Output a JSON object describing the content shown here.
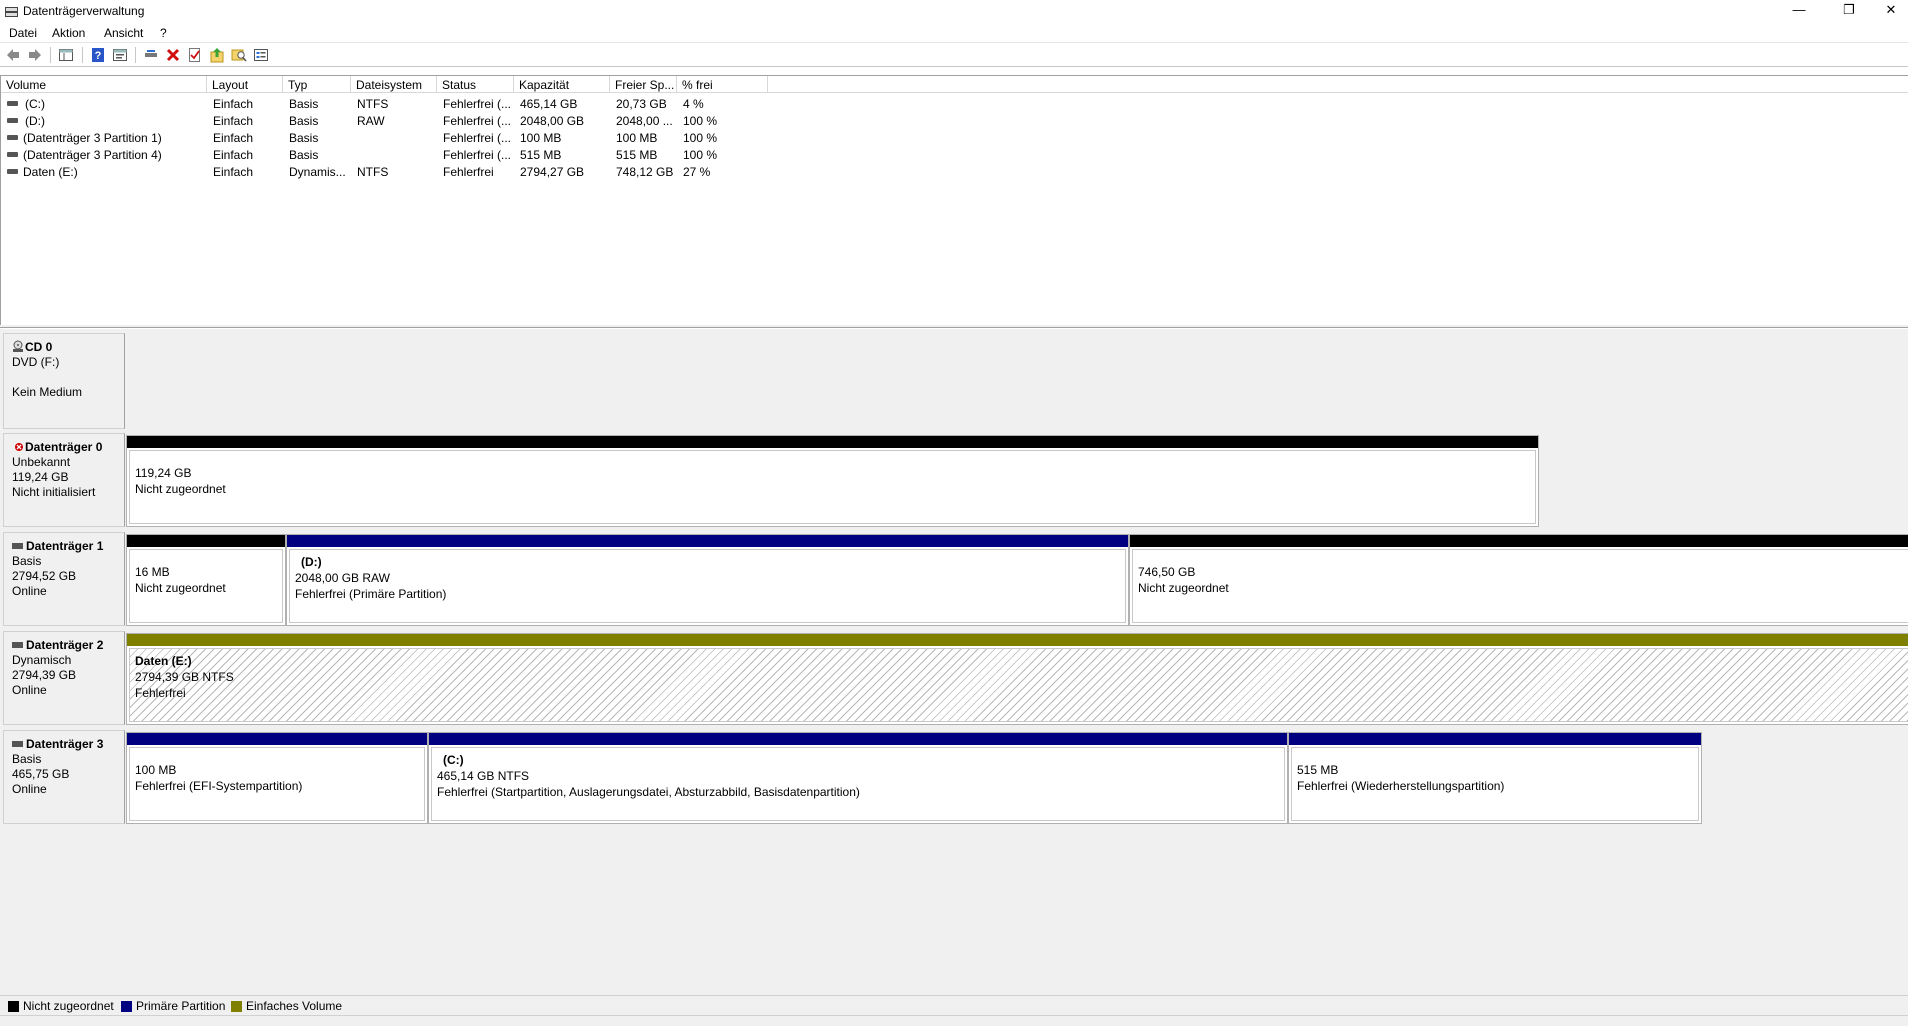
{
  "window": {
    "title": "Datenträgerverwaltung",
    "minimize": "—",
    "maximize": "❐",
    "close": "✕"
  },
  "menu": [
    "Datei",
    "Aktion",
    "Ansicht",
    "?"
  ],
  "toolbar": {
    "icons": [
      "back-icon",
      "forward-icon",
      "console-tree-icon",
      "help-icon",
      "properties-icon",
      "connect-icon",
      "delete-icon",
      "check-icon",
      "import-icon",
      "search-icon",
      "list-icon"
    ]
  },
  "volume_list": {
    "columns": [
      "Volume",
      "Layout",
      "Typ",
      "Dateisystem",
      "Status",
      "Kapazität",
      "Freier Sp...",
      "% frei"
    ],
    "rows": [
      [
        "(C:)",
        "Einfach",
        "Basis",
        "NTFS",
        "Fehlerfrei (...",
        "465,14 GB",
        "20,73 GB",
        "4 %"
      ],
      [
        "(D:)",
        "Einfach",
        "Basis",
        "RAW",
        "Fehlerfrei (...",
        "2048,00 GB",
        "2048,00 ...",
        "100 %"
      ],
      [
        "(Datenträger 3 Partition 1)",
        "Einfach",
        "Basis",
        "",
        "Fehlerfrei (...",
        "100 MB",
        "100 MB",
        "100 %"
      ],
      [
        "(Datenträger 3 Partition 4)",
        "Einfach",
        "Basis",
        "",
        "Fehlerfrei (...",
        "515 MB",
        "515 MB",
        "100 %"
      ],
      [
        "Daten (E:)",
        "Einfach",
        "Dynamis...",
        "NTFS",
        "Fehlerfrei",
        "2794,27 GB",
        "748,12 GB",
        "27 %"
      ]
    ]
  },
  "disks": [
    {
      "name": "CD 0",
      "lines": [
        "DVD (F:)",
        "",
        "Kein Medium"
      ],
      "partitions": []
    },
    {
      "name": "Datenträger 0",
      "lines": [
        "Unbekannt",
        "119,24 GB",
        "Nicht initialisiert"
      ],
      "partitions": [
        {
          "title": "",
          "lines": [
            "119,24 GB",
            "Nicht zugeordnet"
          ],
          "type": "unallocated"
        }
      ]
    },
    {
      "name": "Datenträger 1",
      "lines": [
        "Basis",
        "2794,52 GB",
        "Online"
      ],
      "partitions": [
        {
          "title": "",
          "lines": [
            "16 MB",
            "Nicht zugeordnet"
          ],
          "type": "unallocated"
        },
        {
          "title": "(D:)",
          "lines": [
            "2048,00 GB RAW",
            "Fehlerfrei (Primäre Partition)"
          ],
          "type": "primary"
        },
        {
          "title": "",
          "lines": [
            "746,50 GB",
            "Nicht zugeordnet"
          ],
          "type": "unallocated"
        }
      ]
    },
    {
      "name": "Datenträger 2",
      "lines": [
        "Dynamisch",
        "2794,39 GB",
        "Online"
      ],
      "partitions": [
        {
          "title": "Daten  (E:)",
          "lines": [
            "2794,39 GB NTFS",
            "Fehlerfrei"
          ],
          "type": "simple"
        }
      ]
    },
    {
      "name": "Datenträger 3",
      "lines": [
        "Basis",
        "465,75 GB",
        "Online"
      ],
      "partitions": [
        {
          "title": "",
          "lines": [
            "100 MB",
            "Fehlerfrei (EFI-Systempartition)"
          ],
          "type": "primary"
        },
        {
          "title": "(C:)",
          "lines": [
            "465,14 GB NTFS",
            "Fehlerfrei (Startpartition, Auslagerungsdatei, Absturzabbild, Basisdatenpartition)"
          ],
          "type": "primary"
        },
        {
          "title": "",
          "lines": [
            "515 MB",
            "Fehlerfrei (Wiederherstellungspartition)"
          ],
          "type": "primary"
        }
      ]
    }
  ],
  "legend": [
    {
      "label": "Nicht zugeordnet",
      "color": "#000000"
    },
    {
      "label": "Primäre Partition",
      "color": "#000080"
    },
    {
      "label": "Einfaches Volume",
      "color": "#808000"
    }
  ],
  "colors": {
    "unallocated": "#000000",
    "primary": "#000080",
    "simple": "#808000"
  }
}
